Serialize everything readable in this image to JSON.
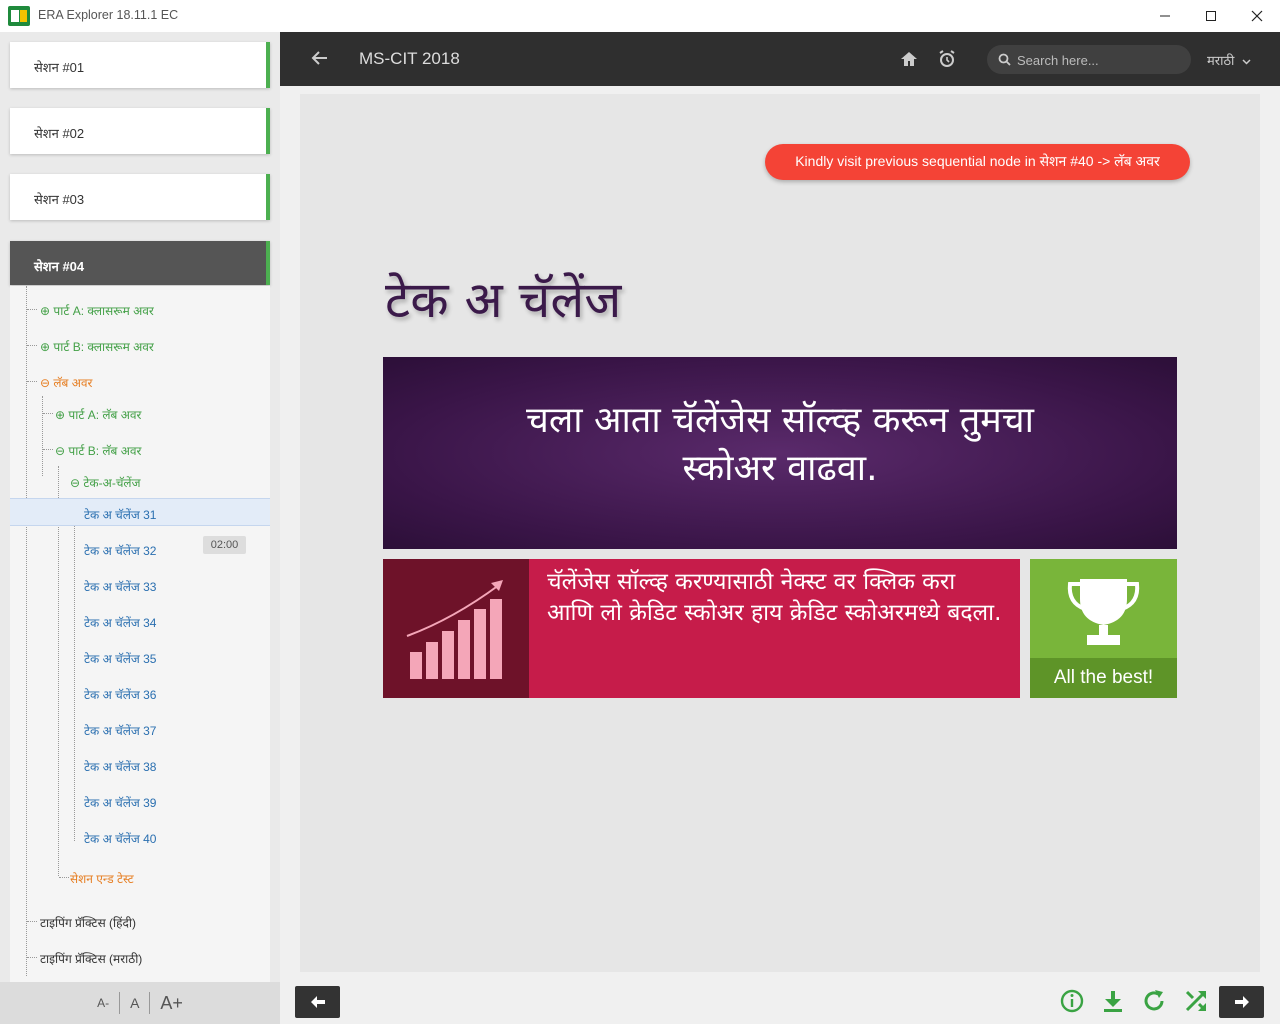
{
  "window": {
    "title": "ERA Explorer 18.11.1 EC",
    "controls": [
      "minimize",
      "maximize",
      "close"
    ]
  },
  "sidebar": {
    "sessions": [
      {
        "label": "सेशन #01"
      },
      {
        "label": "सेशन #02"
      },
      {
        "label": "सेशन #03"
      },
      {
        "label": "सेशन #04"
      }
    ],
    "tree": {
      "part_a_class": "⊕ पार्ट A: क्लासरूम अवर",
      "part_b_class": "⊕ पार्ट B: क्लासरूम अवर",
      "lab_hour": "⊖ लॅब अवर",
      "part_a_lab": "⊕ पार्ट A: लॅब अवर",
      "part_b_lab": "⊖ पार्ट B: लॅब अवर",
      "tech_challenge": "⊖ टेक-अ-चॅलेंज",
      "challenges": [
        "टेक अ चॅलेंज 31",
        "टेक अ चॅलेंज 32",
        "टेक अ चॅलेंज 33",
        "टेक अ चॅलेंज 34",
        "टेक अ चॅलेंज 35",
        "टेक अ चॅलेंज 36",
        "टेक अ चॅलेंज 37",
        "टेक अ चॅलेंज 38",
        "टेक अ चॅलेंज 39",
        "टेक अ चॅलेंज 40"
      ],
      "time_badge": "02:00",
      "session_end_test": "सेशन एन्ड टेस्ट",
      "typing_hindi": "टाइपिंग प्रॅक्टिस (हिंदी)",
      "typing_marathi": "टाइपिंग प्रॅक्टिस (मराठी)"
    },
    "font_controls": {
      "decrease": "A-",
      "normal": "A",
      "increase": "A+"
    }
  },
  "header": {
    "title": "MS-CIT 2018",
    "search_placeholder": "Search here...",
    "language": "मराठी"
  },
  "content": {
    "notice": "Kindly visit previous sequential node in सेशन #40 -> लॅब अवर",
    "slide_title": "टेक अ चॅलेंज",
    "purple_text_line1": "चला आता चॅलेंजेस सॉल्व्ह करून तुमचा",
    "purple_text_line2": "स्कोअर वाढवा.",
    "red_text": "चॅलेंजेस सॉल्व्ह करण्यासाठी नेक्स्ट वर क्लिक करा आणि लो क्रेडिट स्कोअर हाय क्रेडिट स्कोअरमध्ये बदला.",
    "green_label": "All the best!"
  },
  "colors": {
    "accent_green": "#4caf50",
    "notice_red": "#f44336",
    "header_dark": "#2f2f2f",
    "slide_purple": "#3a1548",
    "slide_red": "#c61c4a",
    "slide_green": "#79b53a"
  },
  "footer": {
    "icons": [
      "info-icon",
      "download-icon",
      "refresh-icon",
      "shuffle-icon"
    ]
  }
}
